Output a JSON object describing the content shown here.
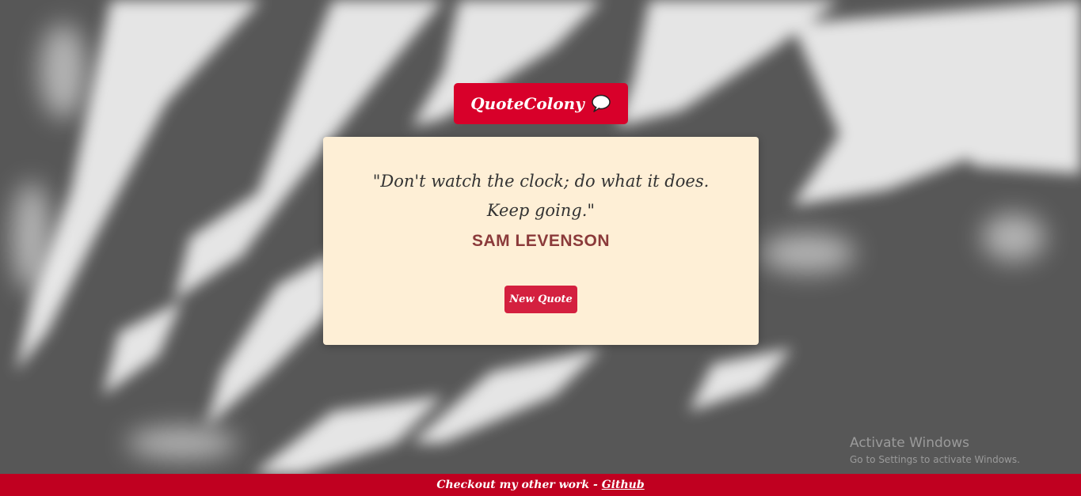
{
  "header": {
    "brand": "QuoteColony",
    "brand_icon": "speech-bubble-icon"
  },
  "quote": {
    "text": "\"Don't watch the clock; do what it does. Keep going.\"",
    "author": "SAM LEVENSON",
    "new_quote_label": "New Quote"
  },
  "footer": {
    "text": "Checkout my other work -",
    "link_label": "Github"
  },
  "watermark": {
    "title": "Activate Windows",
    "subtitle": "Go to Settings to activate Windows."
  },
  "colors": {
    "brand_red": "#d8002a",
    "card_bg": "#feefd6",
    "author": "#8b3a3a",
    "button": "#d4203f",
    "footer": "#c00020"
  }
}
